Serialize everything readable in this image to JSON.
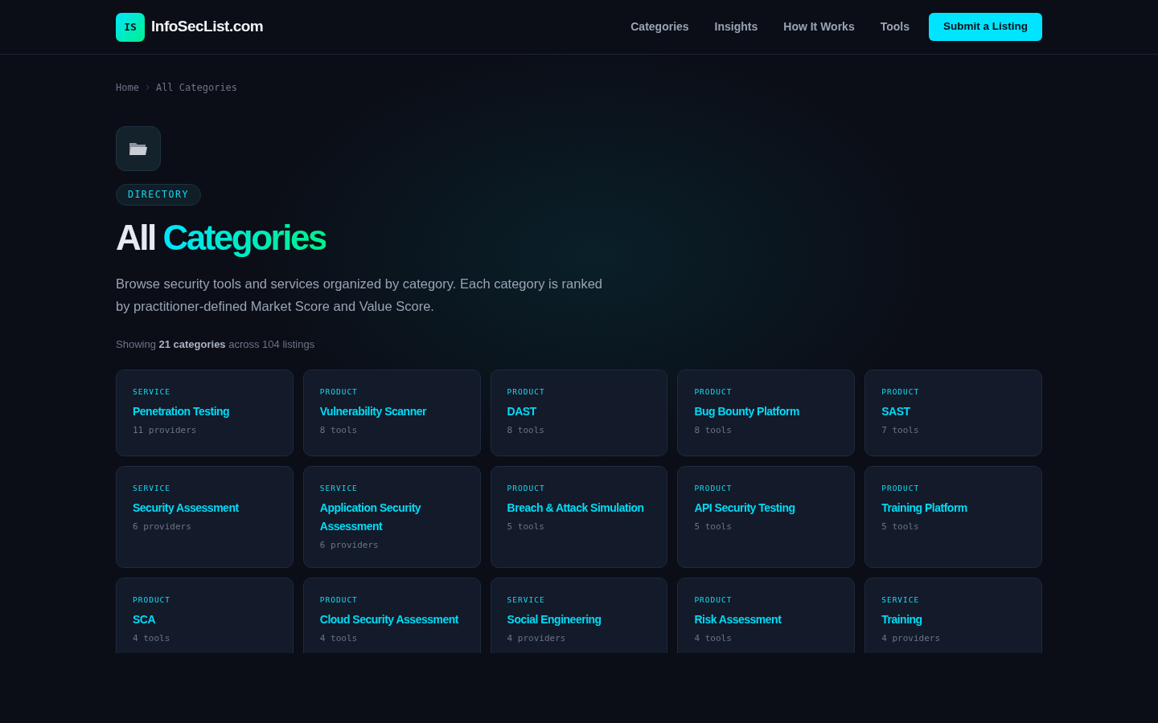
{
  "brand": {
    "logo": "IS",
    "name": "InfoSecList.com"
  },
  "nav": [
    {
      "label": "Categories"
    },
    {
      "label": "Insights"
    },
    {
      "label": "How It Works"
    },
    {
      "label": "Tools"
    }
  ],
  "cta": "Submit a Listing",
  "breadcrumb": [
    {
      "label": "Home"
    },
    {
      "label": "All Categories"
    }
  ],
  "badge": "DIRECTORY",
  "title": {
    "text": "All",
    "highlight": "Categories"
  },
  "description": "Browse security tools and services organized by category. Each category is ranked by practitioner-defined Market Score and Value Score.",
  "summary": "Showing **21 categories** across 104 listings",
  "categories": [
    {
      "type": "SERVICE",
      "name": "Penetration Testing",
      "count": "11 providers"
    },
    {
      "type": "PRODUCT",
      "name": "Vulnerability Scanner",
      "count": "8 tools"
    },
    {
      "type": "PRODUCT",
      "name": "DAST",
      "count": "8 tools"
    },
    {
      "type": "PRODUCT",
      "name": "Bug Bounty Platform",
      "count": "8 tools"
    },
    {
      "type": "PRODUCT",
      "name": "SAST",
      "count": "7 tools"
    },
    {
      "type": "SERVICE",
      "name": "Security Assessment",
      "count": "6 providers"
    },
    {
      "type": "SERVICE",
      "name": "Application Security Assessment",
      "count": "6 providers"
    },
    {
      "type": "PRODUCT",
      "name": "Breach & Attack Simulation",
      "count": "5 tools"
    },
    {
      "type": "PRODUCT",
      "name": "API Security Testing",
      "count": "5 tools"
    },
    {
      "type": "PRODUCT",
      "name": "Training Platform",
      "count": "5 tools"
    },
    {
      "type": "PRODUCT",
      "name": "SCA",
      "count": "4 tools"
    },
    {
      "type": "PRODUCT",
      "name": "Cloud Security Assessment",
      "count": "4 tools"
    },
    {
      "type": "SERVICE",
      "name": "Social Engineering",
      "count": "4 providers"
    },
    {
      "type": "PRODUCT",
      "name": "Risk Assessment",
      "count": "4 tools"
    },
    {
      "type": "SERVICE",
      "name": "Training",
      "count": "4 providers"
    }
  ]
}
